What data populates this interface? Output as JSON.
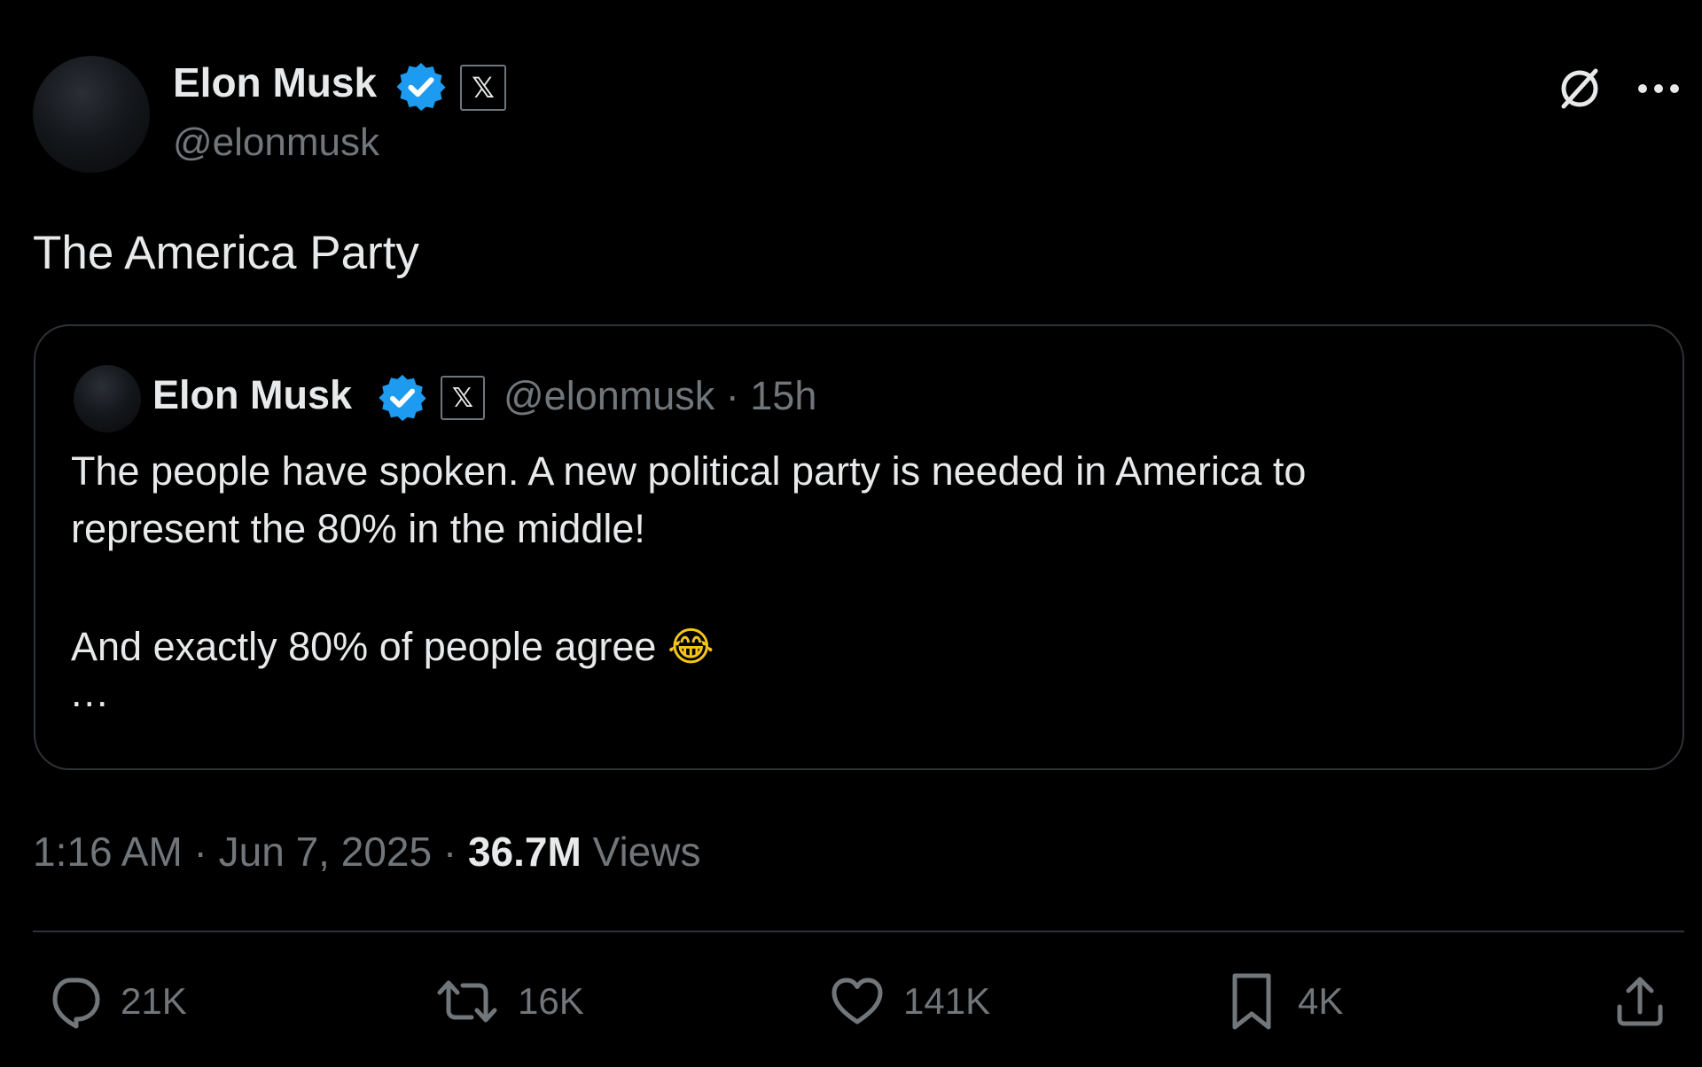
{
  "author": {
    "name": "Elon Musk",
    "handle": "@elonmusk",
    "affiliate_badge": "𝕏"
  },
  "post": {
    "text": "The America Party",
    "timestamp": "1:16 AM · Jun 7, 2025",
    "separator": "·",
    "views_count": "36.7M",
    "views_label": "Views"
  },
  "quoted": {
    "name": "Elon Musk",
    "affiliate_badge": "𝕏",
    "meta": "@elonmusk · 15h",
    "line1": "The people have spoken. A new political party is needed in America to",
    "line2": "represent the 80% in the middle!",
    "line3": "And exactly 80% of people agree",
    "emoji": "😂",
    "ellipsis": "..."
  },
  "actions": {
    "reply_count": "21K",
    "repost_count": "16K",
    "like_count": "141K",
    "bookmark_count": "4K"
  },
  "colors": {
    "background": "#000000",
    "text_primary": "#e7e9ea",
    "text_secondary": "#71767b",
    "border": "#2f3336",
    "verified": "#1d9bf0"
  },
  "icons": {
    "verified": "verified-badge-icon",
    "grok": "grok-icon",
    "more": "more-icon",
    "reply": "reply-icon",
    "repost": "repost-icon",
    "like": "like-icon",
    "bookmark": "bookmark-icon",
    "share": "share-icon"
  }
}
